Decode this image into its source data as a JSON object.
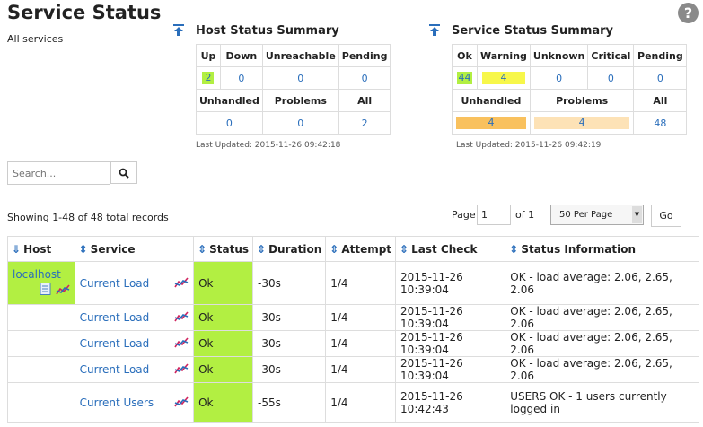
{
  "page": {
    "title": "Service Status",
    "subtitle": "All services",
    "help_glyph": "?"
  },
  "host_summary": {
    "title": "Host Status Summary",
    "headers": [
      "Up",
      "Down",
      "Unreachable",
      "Pending"
    ],
    "values": [
      "2",
      "0",
      "0",
      "0"
    ],
    "headers2": [
      "Unhandled",
      "Problems",
      "All"
    ],
    "values2": [
      "0",
      "0",
      "2"
    ],
    "last_updated": "Last Updated: 2015-11-26 09:42:18"
  },
  "service_summary": {
    "title": "Service Status Summary",
    "headers": [
      "Ok",
      "Warning",
      "Unknown",
      "Critical",
      "Pending"
    ],
    "values": [
      "44",
      "4",
      "0",
      "0",
      "0"
    ],
    "headers2": [
      "Unhandled",
      "Problems",
      "All"
    ],
    "values2": [
      "4",
      "4",
      "48"
    ],
    "last_updated": "Last Updated: 2015-11-26 09:42:19"
  },
  "search": {
    "placeholder": "Search..."
  },
  "records": {
    "label": "Showing 1-48 of 48 total records"
  },
  "pagination": {
    "page_label": "Page",
    "page_value": "1",
    "of_label": "of 1",
    "per_page": "50 Per Page",
    "go_label": "Go"
  },
  "table": {
    "columns": [
      "Host",
      "Service",
      "Status",
      "Duration",
      "Attempt",
      "Last Check",
      "Status Information"
    ],
    "rows": [
      {
        "host": "localhost",
        "service": "Current Load",
        "status": "Ok",
        "duration": "-30s",
        "attempt": "1/4",
        "last_check": "2015-11-26 10:39:04",
        "info": "OK - load average: 2.06, 2.65, 2.06"
      },
      {
        "host": "",
        "service": "Current Load",
        "status": "Ok",
        "duration": "-30s",
        "attempt": "1/4",
        "last_check": "2015-11-26 10:39:04",
        "info": "OK - load average: 2.06, 2.65, 2.06"
      },
      {
        "host": "",
        "service": "Current Load",
        "status": "Ok",
        "duration": "-30s",
        "attempt": "1/4",
        "last_check": "2015-11-26 10:39:04",
        "info": "OK - load average: 2.06, 2.65, 2.06"
      },
      {
        "host": "",
        "service": "Current Load",
        "status": "Ok",
        "duration": "-30s",
        "attempt": "1/4",
        "last_check": "2015-11-26 10:39:04",
        "info": "OK - load average: 2.06, 2.65, 2.06"
      },
      {
        "host": "",
        "service": "Current Users",
        "status": "Ok",
        "duration": "-55s",
        "attempt": "1/4",
        "last_check": "2015-11-26 10:42:43",
        "info": "USERS OK - 1 users currently logged in"
      }
    ]
  },
  "colors": {
    "ok": "#b2ef42",
    "warning": "#f7f74a",
    "unhandled": "#f9c15e",
    "problems": "#fde2b6",
    "link": "#2a6ebb"
  },
  "icons": {
    "sort": "sort-arrow-icon",
    "graph": "graph-icon",
    "notes": "notes-icon",
    "search": "search-icon",
    "collapse": "collapse-up-icon",
    "help": "help-icon"
  }
}
